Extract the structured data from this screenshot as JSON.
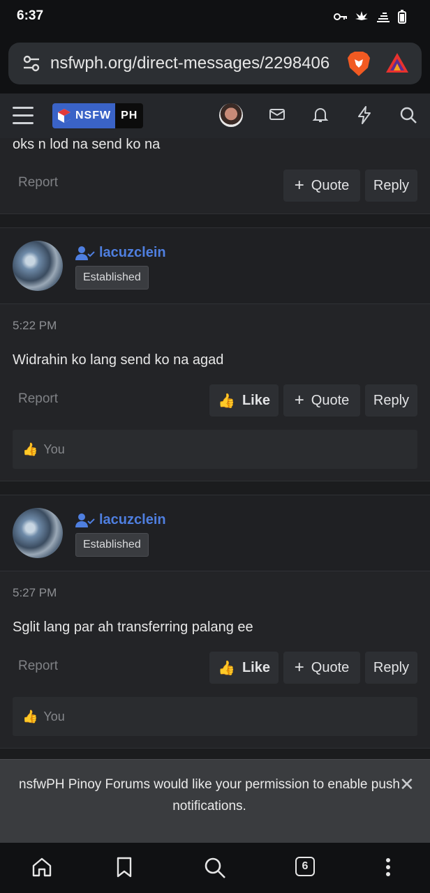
{
  "status": {
    "time": "6:37"
  },
  "browser": {
    "url": "nsfwph.org/direct-messages/2298406",
    "tab_count": "6"
  },
  "nav": {
    "logo_left": "NSFW",
    "logo_right": "PH"
  },
  "messages": [
    {
      "text": "oks n lod na send ko na",
      "report": "Report",
      "quote": "Quote",
      "reply": "Reply"
    },
    {
      "username": "lacuzclein",
      "badge": "Established",
      "time": "5:22 PM",
      "text": "Widrahin ko lang send ko na agad",
      "report": "Report",
      "like": "Like",
      "quote": "Quote",
      "reply": "Reply",
      "reaction_user": "You"
    },
    {
      "username": "lacuzclein",
      "badge": "Established",
      "time": "5:27 PM",
      "text": "Sglit lang par ah transferring palang ee",
      "report": "Report",
      "like": "Like",
      "quote": "Quote",
      "reply": "Reply",
      "reaction_user": "You"
    }
  ],
  "toast": {
    "message": "nsfwPH Pinoy Forums would like your permission to enable push notifications."
  },
  "colors": {
    "accent": "#4f7fe0",
    "background": "#1b1c1e"
  }
}
